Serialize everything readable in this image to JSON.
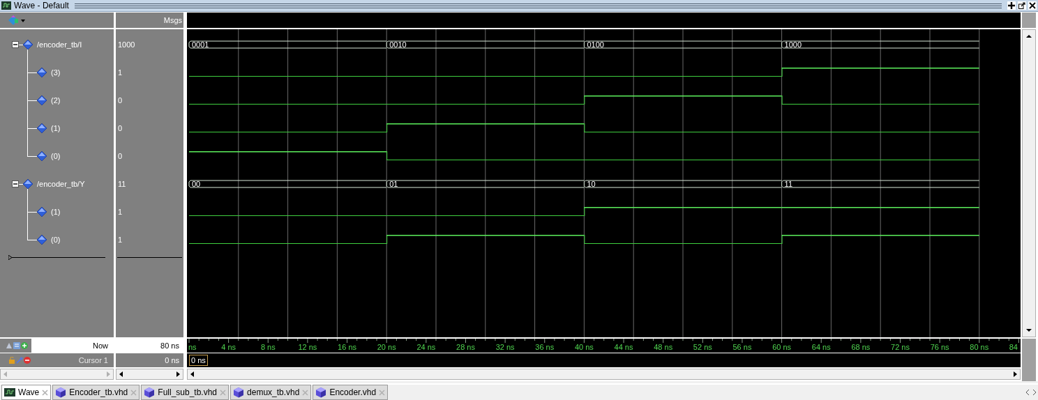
{
  "window": {
    "title": "Wave - Default"
  },
  "header": {
    "values_column": "Msgs"
  },
  "signals": [
    {
      "name": "/encoder_tb/I",
      "value": "1000",
      "expanded": true,
      "segments": [
        {
          "label": "0001"
        },
        {
          "label": "0010"
        },
        {
          "label": "0100"
        },
        {
          "label": "1000"
        }
      ],
      "children": [
        {
          "name": "(3)",
          "value": "1",
          "segments": [
            {
              "high": false
            },
            {
              "high": false
            },
            {
              "high": false
            },
            {
              "high": true
            }
          ]
        },
        {
          "name": "(2)",
          "value": "0",
          "segments": [
            {
              "high": false
            },
            {
              "high": false
            },
            {
              "high": true
            },
            {
              "high": false
            }
          ]
        },
        {
          "name": "(1)",
          "value": "0",
          "segments": [
            {
              "high": false
            },
            {
              "high": true
            },
            {
              "high": false
            },
            {
              "high": false
            }
          ]
        },
        {
          "name": "(0)",
          "value": "0",
          "segments": [
            {
              "high": true
            },
            {
              "high": false
            },
            {
              "high": false
            },
            {
              "high": false
            }
          ]
        }
      ]
    },
    {
      "name": "/encoder_tb/Y",
      "value": "11",
      "expanded": true,
      "segments": [
        {
          "label": "00"
        },
        {
          "label": "01"
        },
        {
          "label": "10"
        },
        {
          "label": "11"
        }
      ],
      "children": [
        {
          "name": "(1)",
          "value": "1",
          "segments": [
            {
              "high": false
            },
            {
              "high": false
            },
            {
              "high": true
            },
            {
              "high": true
            }
          ]
        },
        {
          "name": "(0)",
          "value": "1",
          "segments": [
            {
              "high": false
            },
            {
              "high": true
            },
            {
              "high": false
            },
            {
              "high": true
            }
          ]
        }
      ]
    }
  ],
  "now": {
    "label": "Now",
    "value": "80 ns"
  },
  "cursor": {
    "label": "Cursor 1",
    "value": "0 ns",
    "marker": "0 ns"
  },
  "timeline": [
    "ns",
    "4 ns",
    "8 ns",
    "12 ns",
    "16 ns",
    "20 ns",
    "24 ns",
    "28 ns",
    "32 ns",
    "36 ns",
    "40 ns",
    "44 ns",
    "48 ns",
    "52 ns",
    "56 ns",
    "60 ns",
    "64 ns",
    "68 ns",
    "72 ns",
    "76 ns",
    "80 ns",
    "84"
  ],
  "tabs": [
    {
      "label": "Wave",
      "kind": "wave",
      "selected": true
    },
    {
      "label": "Encoder_tb.vhd",
      "kind": "source",
      "selected": false
    },
    {
      "label": "Full_sub_tb.vhd",
      "kind": "source",
      "selected": false
    },
    {
      "label": "demux_tb.vhd",
      "kind": "source",
      "selected": false
    },
    {
      "label": "Encoder.vhd",
      "kind": "source",
      "selected": false
    }
  ]
}
